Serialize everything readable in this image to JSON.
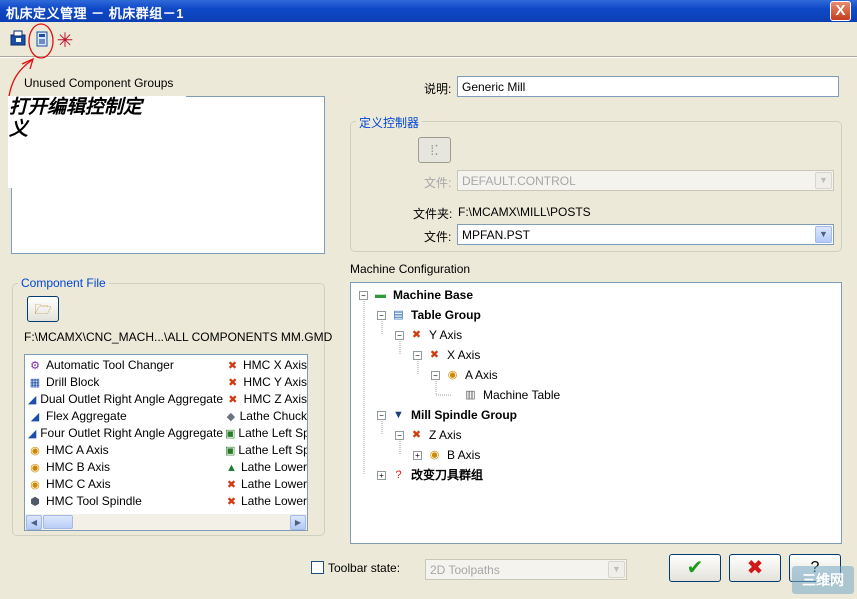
{
  "window": {
    "title": "机床定义管理  －  机床群组－1",
    "close_glyph": "X"
  },
  "toolbar": {
    "buttons": [
      {
        "icon": "open-file-icon"
      },
      {
        "icon": "edit-control-icon"
      },
      {
        "icon": "asterisk-icon"
      }
    ]
  },
  "annotation": {
    "text_line1": "打开编辑控制定",
    "text_line2": "义"
  },
  "unused_groups": {
    "title": "Unused Component Groups"
  },
  "description": {
    "label": "说明:",
    "value": "Generic Mill"
  },
  "control_definition": {
    "title": "定义控制器",
    "file_label": "文件:",
    "file_value": "DEFAULT.CONTROL",
    "folder_label": "文件夹:",
    "folder_value": "F:\\MCAMX\\MILL\\POSTS",
    "post_label": "文件:",
    "post_value": "MPFAN.PST"
  },
  "component_file": {
    "title": "Component File",
    "path": "F:\\MCAMX\\CNC_MACH...\\ALL COMPONENTS MM.GMD",
    "col1": [
      {
        "label": "Automatic Tool Changer",
        "icon": "tool-changer-icon"
      },
      {
        "label": "Drill Block",
        "icon": "drill-block-icon"
      },
      {
        "label": "Dual Outlet Right Angle Aggregate",
        "icon": "aggregate-icon"
      },
      {
        "label": "Flex Aggregate",
        "icon": "aggregate-icon"
      },
      {
        "label": "Four Outlet Right Angle Aggregate",
        "icon": "aggregate-icon"
      },
      {
        "label": "HMC A Axis",
        "icon": "rotary-axis-icon"
      },
      {
        "label": "HMC B Axis",
        "icon": "rotary-axis-icon"
      },
      {
        "label": "HMC C Axis",
        "icon": "rotary-axis-icon"
      },
      {
        "label": "HMC Tool Spindle",
        "icon": "spindle-icon"
      }
    ],
    "col2": [
      {
        "label": "HMC X Axis",
        "icon": "linear-axis-icon"
      },
      {
        "label": "HMC Y Axis",
        "icon": "linear-axis-icon"
      },
      {
        "label": "HMC Z Axis",
        "icon": "linear-axis-icon"
      },
      {
        "label": "Lathe Chuck",
        "icon": "chuck-icon"
      },
      {
        "label": "Lathe Left Sp",
        "icon": "lathe-spindle-icon"
      },
      {
        "label": "Lathe Left Sp",
        "icon": "lathe-spindle-icon"
      },
      {
        "label": "Lathe Lower",
        "icon": "lathe-turret-icon"
      },
      {
        "label": "Lathe Lower",
        "icon": "linear-axis-icon"
      },
      {
        "label": "Lathe Lower",
        "icon": "linear-axis-icon"
      }
    ]
  },
  "machine_config": {
    "title": "Machine Configuration",
    "tree": [
      {
        "label": "Machine Base",
        "level": 0,
        "expander": "−",
        "bold": true,
        "icon": "machine-base-icon"
      },
      {
        "label": "Table Group",
        "level": 1,
        "expander": "−",
        "bold": true,
        "icon": "table-group-icon"
      },
      {
        "label": "Y Axis",
        "level": 2,
        "expander": "−",
        "bold": false,
        "icon": "linear-axis-icon"
      },
      {
        "label": "X Axis",
        "level": 3,
        "expander": "−",
        "bold": false,
        "icon": "linear-axis-icon"
      },
      {
        "label": "A Axis",
        "level": 4,
        "expander": "−",
        "bold": false,
        "icon": "rotary-axis-icon"
      },
      {
        "label": "Machine Table",
        "level": 5,
        "expander": "",
        "bold": false,
        "icon": "machine-table-icon"
      },
      {
        "label": "Mill Spindle Group",
        "level": 1,
        "expander": "−",
        "bold": true,
        "icon": "spindle-group-icon"
      },
      {
        "label": "Z Axis",
        "level": 2,
        "expander": "−",
        "bold": false,
        "icon": "linear-axis-icon"
      },
      {
        "label": "B Axis",
        "level": 3,
        "expander": "+",
        "bold": false,
        "icon": "rotary-axis-icon"
      },
      {
        "label": "改变刀具群组",
        "level": 1,
        "expander": "+",
        "bold": true,
        "icon": "question-icon"
      }
    ]
  },
  "bottom": {
    "toolbar_state_label": "Toolbar state:",
    "toolbar_state_value": "2D Toolpaths",
    "ok_glyph": "✔",
    "cancel_glyph": "✖",
    "help_glyph": "?"
  },
  "watermark": {
    "text": "三维网"
  },
  "colors": {
    "titlebar": "#0f48c8",
    "group_title": "#0046d5",
    "annotation_mark": "#e01010"
  }
}
